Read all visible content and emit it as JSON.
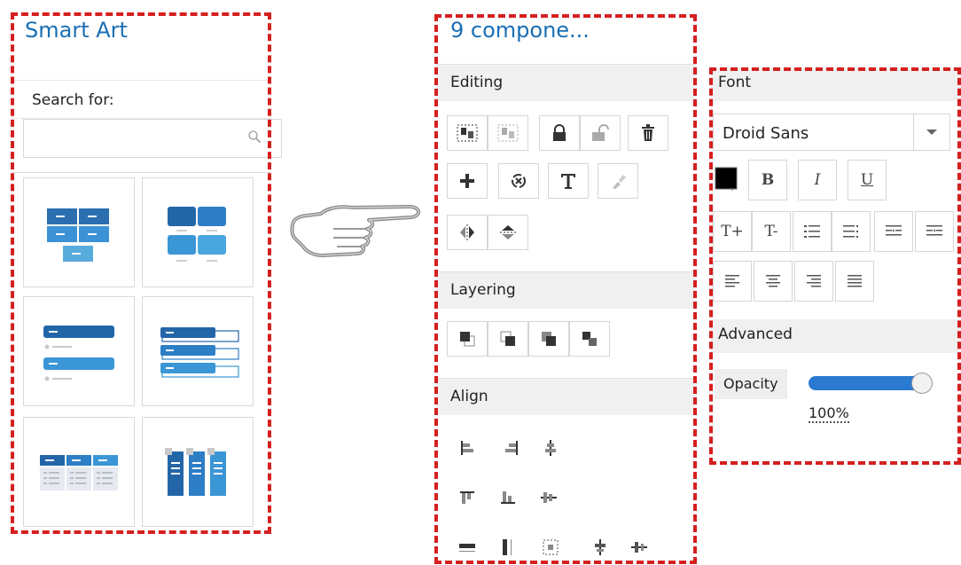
{
  "smart_art": {
    "title": "Smart Art",
    "search_label": "Search for:",
    "search_value": "",
    "templates": [
      "hierarchy-grid",
      "two-by-two-blocks",
      "two-bars-list",
      "stacked-bars",
      "three-column-table",
      "three-column-cards"
    ]
  },
  "components": {
    "title": "9 compone...",
    "sections": {
      "editing": "Editing",
      "layering": "Layering",
      "align": "Align"
    },
    "editing_tools": [
      "group-icon",
      "ungroup-icon",
      "lock-icon",
      "unlock-icon",
      "delete-icon",
      "add-icon",
      "replace-icon",
      "text-icon",
      "format-painter-icon",
      "flip-horizontal-icon",
      "flip-vertical-icon"
    ],
    "layering_tools": [
      "bring-to-front-icon",
      "send-to-back-icon",
      "bring-forward-icon",
      "send-backward-icon"
    ],
    "align_tools": [
      "align-left-icon",
      "align-right-icon",
      "align-center-horizontal-icon",
      "align-top-icon",
      "align-bottom-icon",
      "align-middle-icon",
      "distribute-horizontal-icon",
      "distribute-vertical-icon",
      "same-size-icon",
      "center-horizontal-icon",
      "center-vertical-icon"
    ]
  },
  "font_panel": {
    "title": "Font",
    "font_family": "Droid Sans",
    "text_color": "#000000",
    "style_buttons": {
      "bold": "B",
      "italic": "I",
      "underline": "U"
    },
    "size_buttons": {
      "grow": "T+",
      "shrink": "T-"
    },
    "advanced_title": "Advanced",
    "opacity_label": "Opacity",
    "opacity_value": "100%",
    "opacity_fraction": 1.0
  },
  "colors": {
    "accent": "#1a6fb5",
    "highlight": "#d51f1f",
    "slider": "#2a7ad1"
  }
}
